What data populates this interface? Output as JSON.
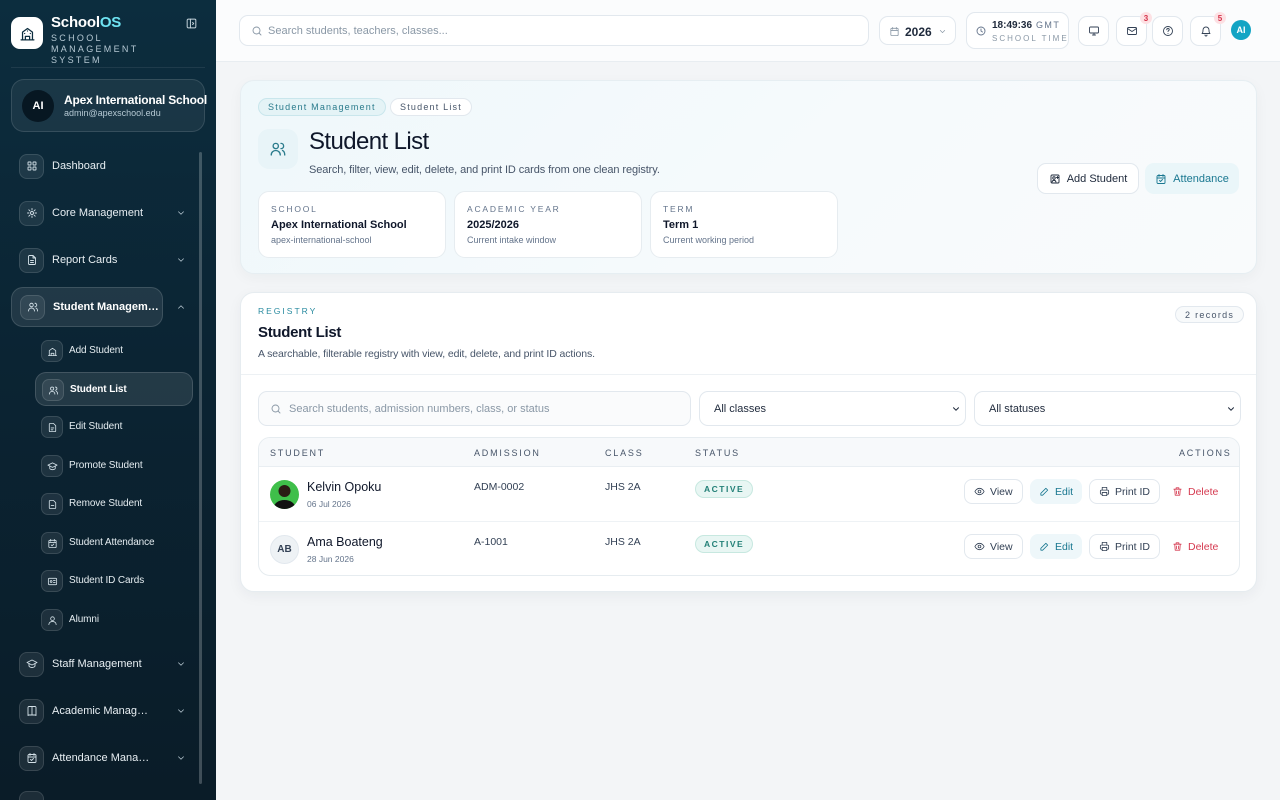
{
  "app": {
    "name": "School",
    "name_accent": "OS",
    "subtitle": "SCHOOL MANAGEMENT SYSTEM"
  },
  "school": {
    "initials": "AI",
    "name": "Apex International School",
    "email": "admin@apexschool.edu"
  },
  "sidebar": {
    "items": [
      {
        "label": "Dashboard",
        "icon": "grid-icon"
      },
      {
        "label": "Core Management",
        "icon": "settings-icon"
      },
      {
        "label": "Report Cards",
        "icon": "document-icon"
      },
      {
        "label": "Student Management",
        "icon": "users-icon"
      },
      {
        "label": "Staff Management",
        "icon": "graduation-cap-icon"
      },
      {
        "label": "Academic Management",
        "icon": "book-icon"
      },
      {
        "label": "Attendance Management",
        "icon": "calendar-check-icon"
      }
    ],
    "subitems": [
      {
        "label": "Add Student",
        "icon": "building-icon"
      },
      {
        "label": "Student List",
        "icon": "users-icon"
      },
      {
        "label": "Edit Student",
        "icon": "document-edit-icon"
      },
      {
        "label": "Promote Student",
        "icon": "graduation-cap-icon"
      },
      {
        "label": "Remove Student",
        "icon": "document-icon"
      },
      {
        "label": "Student Attendance",
        "icon": "calendar-check-icon"
      },
      {
        "label": "Student ID Cards",
        "icon": "id-card-icon"
      },
      {
        "label": "Alumni",
        "icon": "user-icon"
      }
    ]
  },
  "topbar": {
    "search_placeholder": "Search students, teachers, classes...",
    "year": "2026",
    "time": "18:49:36",
    "timezone": "GMT",
    "time_label": "SCHOOL TIME",
    "mail_count": "3",
    "notification_count": "5",
    "user_initials": "AI"
  },
  "hero": {
    "crumbs": [
      "Student Management",
      "Student List"
    ],
    "title": "Student List",
    "subtitle": "Search, filter, view, edit, delete, and print ID cards from one clean registry.",
    "add_label": "Add Student",
    "attendance_label": "Attendance",
    "cards": [
      {
        "label": "SCHOOL",
        "value": "Apex International School",
        "sub": "apex-international-school"
      },
      {
        "label": "ACADEMIC YEAR",
        "value": "2025/2026",
        "sub": "Current intake window"
      },
      {
        "label": "TERM",
        "value": "Term 1",
        "sub": "Current working period"
      }
    ]
  },
  "registry": {
    "eyebrow": "REGISTRY",
    "title": "Student List",
    "subtitle": "A searchable, filterable registry with view, edit, delete, and print ID actions.",
    "records": "2 records",
    "search_placeholder": "Search students, admission numbers, class, or status",
    "class_filter": "All classes",
    "status_filter": "All statuses",
    "columns": [
      "STUDENT",
      "ADMISSION",
      "CLASS",
      "STATUS",
      "ACTIONS"
    ],
    "actions": {
      "view": "View",
      "edit": "Edit",
      "print": "Print ID",
      "delete": "Delete"
    },
    "rows": [
      {
        "name": "Kelvin Opoku",
        "date": "06 Jul 2026",
        "admission": "ADM-0002",
        "class": "JHS 2A",
        "status": "ACTIVE",
        "initials": ""
      },
      {
        "name": "Ama Boateng",
        "date": "28 Jun 2026",
        "admission": "A-1001",
        "class": "JHS 2A",
        "status": "ACTIVE",
        "initials": "AB"
      }
    ]
  },
  "colors": {
    "sidebar_bg": "#0c2d3e",
    "accent": "#1a7891",
    "danger": "#d53a50",
    "status_active": "#238077"
  }
}
